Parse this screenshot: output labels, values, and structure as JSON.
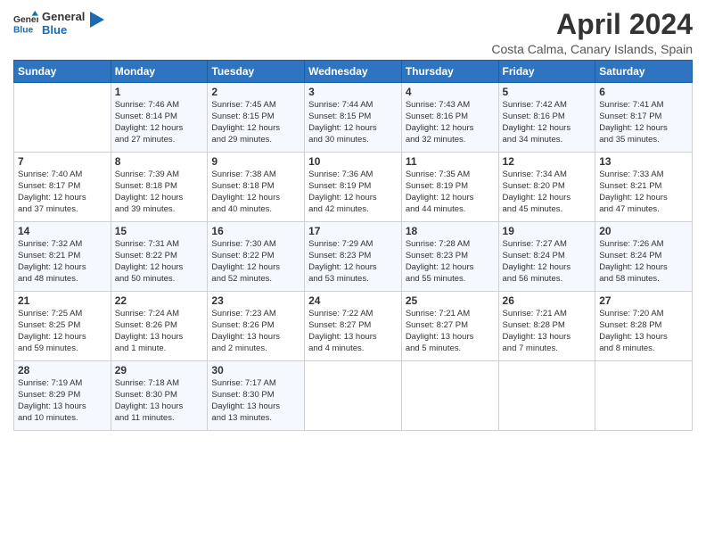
{
  "logo": {
    "general": "General",
    "blue": "Blue"
  },
  "header": {
    "month_year": "April 2024",
    "location": "Costa Calma, Canary Islands, Spain"
  },
  "columns": [
    "Sunday",
    "Monday",
    "Tuesday",
    "Wednesday",
    "Thursday",
    "Friday",
    "Saturday"
  ],
  "weeks": [
    [
      {
        "num": "",
        "info": ""
      },
      {
        "num": "1",
        "info": "Sunrise: 7:46 AM\nSunset: 8:14 PM\nDaylight: 12 hours\nand 27 minutes."
      },
      {
        "num": "2",
        "info": "Sunrise: 7:45 AM\nSunset: 8:15 PM\nDaylight: 12 hours\nand 29 minutes."
      },
      {
        "num": "3",
        "info": "Sunrise: 7:44 AM\nSunset: 8:15 PM\nDaylight: 12 hours\nand 30 minutes."
      },
      {
        "num": "4",
        "info": "Sunrise: 7:43 AM\nSunset: 8:16 PM\nDaylight: 12 hours\nand 32 minutes."
      },
      {
        "num": "5",
        "info": "Sunrise: 7:42 AM\nSunset: 8:16 PM\nDaylight: 12 hours\nand 34 minutes."
      },
      {
        "num": "6",
        "info": "Sunrise: 7:41 AM\nSunset: 8:17 PM\nDaylight: 12 hours\nand 35 minutes."
      }
    ],
    [
      {
        "num": "7",
        "info": "Sunrise: 7:40 AM\nSunset: 8:17 PM\nDaylight: 12 hours\nand 37 minutes."
      },
      {
        "num": "8",
        "info": "Sunrise: 7:39 AM\nSunset: 8:18 PM\nDaylight: 12 hours\nand 39 minutes."
      },
      {
        "num": "9",
        "info": "Sunrise: 7:38 AM\nSunset: 8:18 PM\nDaylight: 12 hours\nand 40 minutes."
      },
      {
        "num": "10",
        "info": "Sunrise: 7:36 AM\nSunset: 8:19 PM\nDaylight: 12 hours\nand 42 minutes."
      },
      {
        "num": "11",
        "info": "Sunrise: 7:35 AM\nSunset: 8:19 PM\nDaylight: 12 hours\nand 44 minutes."
      },
      {
        "num": "12",
        "info": "Sunrise: 7:34 AM\nSunset: 8:20 PM\nDaylight: 12 hours\nand 45 minutes."
      },
      {
        "num": "13",
        "info": "Sunrise: 7:33 AM\nSunset: 8:21 PM\nDaylight: 12 hours\nand 47 minutes."
      }
    ],
    [
      {
        "num": "14",
        "info": "Sunrise: 7:32 AM\nSunset: 8:21 PM\nDaylight: 12 hours\nand 48 minutes."
      },
      {
        "num": "15",
        "info": "Sunrise: 7:31 AM\nSunset: 8:22 PM\nDaylight: 12 hours\nand 50 minutes."
      },
      {
        "num": "16",
        "info": "Sunrise: 7:30 AM\nSunset: 8:22 PM\nDaylight: 12 hours\nand 52 minutes."
      },
      {
        "num": "17",
        "info": "Sunrise: 7:29 AM\nSunset: 8:23 PM\nDaylight: 12 hours\nand 53 minutes."
      },
      {
        "num": "18",
        "info": "Sunrise: 7:28 AM\nSunset: 8:23 PM\nDaylight: 12 hours\nand 55 minutes."
      },
      {
        "num": "19",
        "info": "Sunrise: 7:27 AM\nSunset: 8:24 PM\nDaylight: 12 hours\nand 56 minutes."
      },
      {
        "num": "20",
        "info": "Sunrise: 7:26 AM\nSunset: 8:24 PM\nDaylight: 12 hours\nand 58 minutes."
      }
    ],
    [
      {
        "num": "21",
        "info": "Sunrise: 7:25 AM\nSunset: 8:25 PM\nDaylight: 12 hours\nand 59 minutes."
      },
      {
        "num": "22",
        "info": "Sunrise: 7:24 AM\nSunset: 8:26 PM\nDaylight: 13 hours\nand 1 minute."
      },
      {
        "num": "23",
        "info": "Sunrise: 7:23 AM\nSunset: 8:26 PM\nDaylight: 13 hours\nand 2 minutes."
      },
      {
        "num": "24",
        "info": "Sunrise: 7:22 AM\nSunset: 8:27 PM\nDaylight: 13 hours\nand 4 minutes."
      },
      {
        "num": "25",
        "info": "Sunrise: 7:21 AM\nSunset: 8:27 PM\nDaylight: 13 hours\nand 5 minutes."
      },
      {
        "num": "26",
        "info": "Sunrise: 7:21 AM\nSunset: 8:28 PM\nDaylight: 13 hours\nand 7 minutes."
      },
      {
        "num": "27",
        "info": "Sunrise: 7:20 AM\nSunset: 8:28 PM\nDaylight: 13 hours\nand 8 minutes."
      }
    ],
    [
      {
        "num": "28",
        "info": "Sunrise: 7:19 AM\nSunset: 8:29 PM\nDaylight: 13 hours\nand 10 minutes."
      },
      {
        "num": "29",
        "info": "Sunrise: 7:18 AM\nSunset: 8:30 PM\nDaylight: 13 hours\nand 11 minutes."
      },
      {
        "num": "30",
        "info": "Sunrise: 7:17 AM\nSunset: 8:30 PM\nDaylight: 13 hours\nand 13 minutes."
      },
      {
        "num": "",
        "info": ""
      },
      {
        "num": "",
        "info": ""
      },
      {
        "num": "",
        "info": ""
      },
      {
        "num": "",
        "info": ""
      }
    ]
  ]
}
